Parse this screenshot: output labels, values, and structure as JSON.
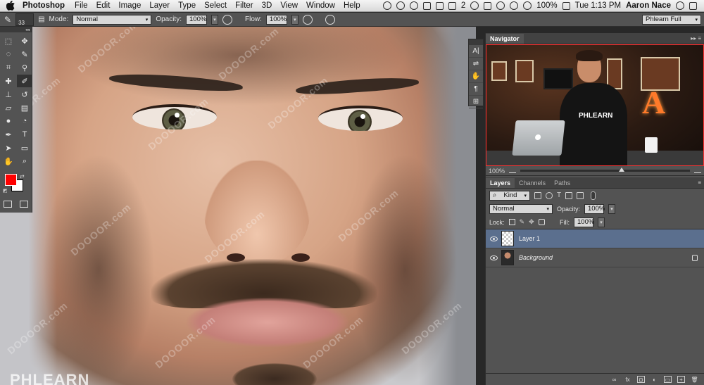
{
  "menubar": {
    "app_name": "Photoshop",
    "items": [
      "File",
      "Edit",
      "Image",
      "Layer",
      "Type",
      "Select",
      "Filter",
      "3D",
      "View",
      "Window",
      "Help"
    ],
    "status_badge": "2",
    "battery": "100%",
    "clock": "Tue 1:13 PM",
    "user": "Aaron Nace"
  },
  "options": {
    "brush_size": "33",
    "mode_label": "Mode:",
    "mode_value": "Normal",
    "opacity_label": "Opacity:",
    "opacity_value": "100%",
    "flow_label": "Flow:",
    "flow_value": "100%",
    "workspace": "Phlearn Full"
  },
  "tools": {
    "icons": [
      "marquee-icon",
      "move-icon",
      "lasso-icon",
      "quick-selection-icon",
      "crop-icon",
      "eyedropper-icon",
      "healing-icon",
      "brush-icon",
      "stamp-icon",
      "history-brush-icon",
      "eraser-icon",
      "gradient-icon",
      "blur-icon",
      "dodge-icon",
      "pen-icon",
      "type-icon",
      "path-selection-icon",
      "rectangle-icon",
      "hand-icon",
      "zoom-icon"
    ],
    "selected_index": 7,
    "foreground_color": "#ff0000",
    "background_color": "#ffffff"
  },
  "canvas": {
    "watermark": "DOOOOR.com",
    "brand": "PHLEARN"
  },
  "navigator": {
    "tab": "Navigator",
    "zoom": "100%",
    "shirt_text": "PHLEARN",
    "neon_letter": "A"
  },
  "layers_panel": {
    "tabs": [
      "Layers",
      "Channels",
      "Paths"
    ],
    "filter_kind": "Kind",
    "blend_mode": "Normal",
    "opacity_label": "Opacity:",
    "opacity_value": "100%",
    "lock_label": "Lock:",
    "fill_label": "Fill:",
    "fill_value": "100%",
    "layers": [
      {
        "name": "Layer 1",
        "selected": true
      },
      {
        "name": "Background",
        "selected": false
      }
    ]
  },
  "colors": {
    "panel": "#535353",
    "selection": "#5b6f8e",
    "foreground": "#ff0000"
  }
}
